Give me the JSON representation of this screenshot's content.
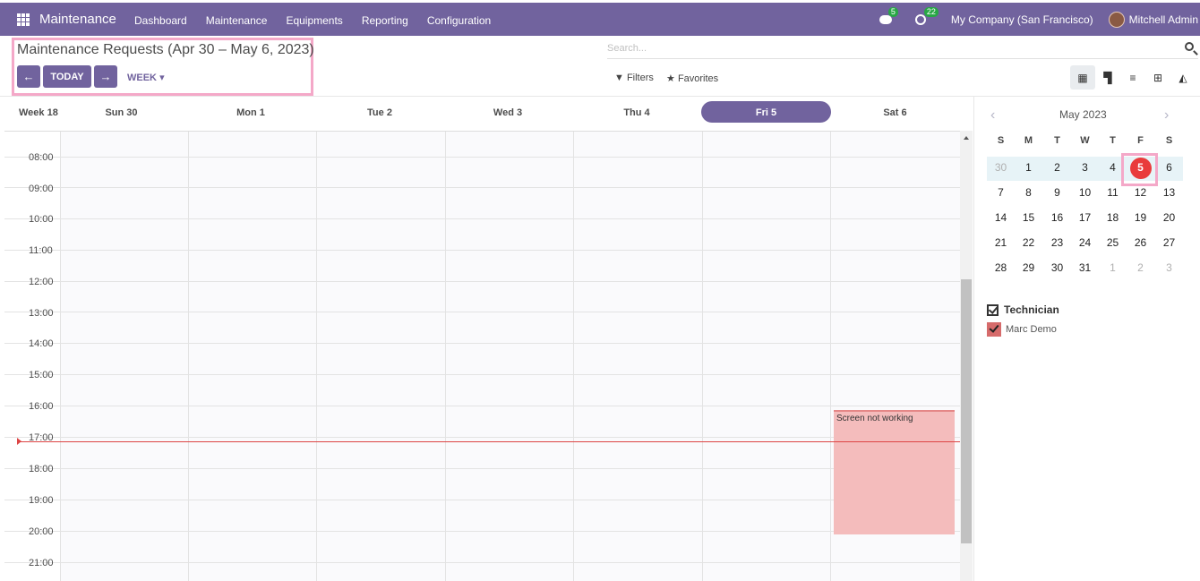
{
  "navbar": {
    "app_name": "Maintenance",
    "menu": [
      "Dashboard",
      "Maintenance",
      "Equipments",
      "Reporting",
      "Configuration"
    ],
    "messages_count": "5",
    "activities_count": "22",
    "company": "My Company (San Francisco)",
    "user": "Mitchell Admin"
  },
  "control_panel": {
    "title": "Maintenance Requests (Apr 30 – May 6, 2023)",
    "prev_icon": "arrow-left-icon",
    "today_label": "TODAY",
    "next_icon": "arrow-right-icon",
    "scale_label": "WEEK",
    "search_placeholder": "Search...",
    "filters_label": "Filters",
    "favorites_label": "Favorites",
    "views": [
      "calendar-icon",
      "kanban-icon",
      "list-icon",
      "pivot-icon",
      "graph-icon"
    ]
  },
  "calendar": {
    "week_label": "Week 18",
    "days": [
      "Sun 30",
      "Mon 1",
      "Tue 2",
      "Wed 3",
      "Thu 4",
      "Fri 5",
      "Sat 6"
    ],
    "today_index": 5,
    "hours": [
      "08:00",
      "09:00",
      "10:00",
      "11:00",
      "12:00",
      "13:00",
      "14:00",
      "15:00",
      "16:00",
      "17:00",
      "18:00",
      "19:00",
      "20:00",
      "21:00"
    ],
    "event": {
      "title": "Screen not working",
      "day": "Sat 6",
      "start": "16:00",
      "end": "20:00",
      "color": "#f4bcbc"
    }
  },
  "sidebar": {
    "month_title": "May 2023",
    "dow": [
      "S",
      "M",
      "T",
      "W",
      "T",
      "F",
      "S"
    ],
    "weeks": [
      [
        "30",
        "1",
        "2",
        "3",
        "4",
        "5",
        "6"
      ],
      [
        "7",
        "8",
        "9",
        "10",
        "11",
        "12",
        "13"
      ],
      [
        "14",
        "15",
        "16",
        "17",
        "18",
        "19",
        "20"
      ],
      [
        "21",
        "22",
        "23",
        "24",
        "25",
        "26",
        "27"
      ],
      [
        "28",
        "29",
        "30",
        "31",
        "1",
        "2",
        "3"
      ]
    ],
    "filter_group": "Technician",
    "filter_items": [
      {
        "label": "Marc Demo",
        "color": "#d66b6b"
      }
    ]
  },
  "colors": {
    "brand": "#71639e",
    "today": "#e93b3b",
    "now_line": "#dd4444",
    "highlight": "#f4a8c8"
  }
}
